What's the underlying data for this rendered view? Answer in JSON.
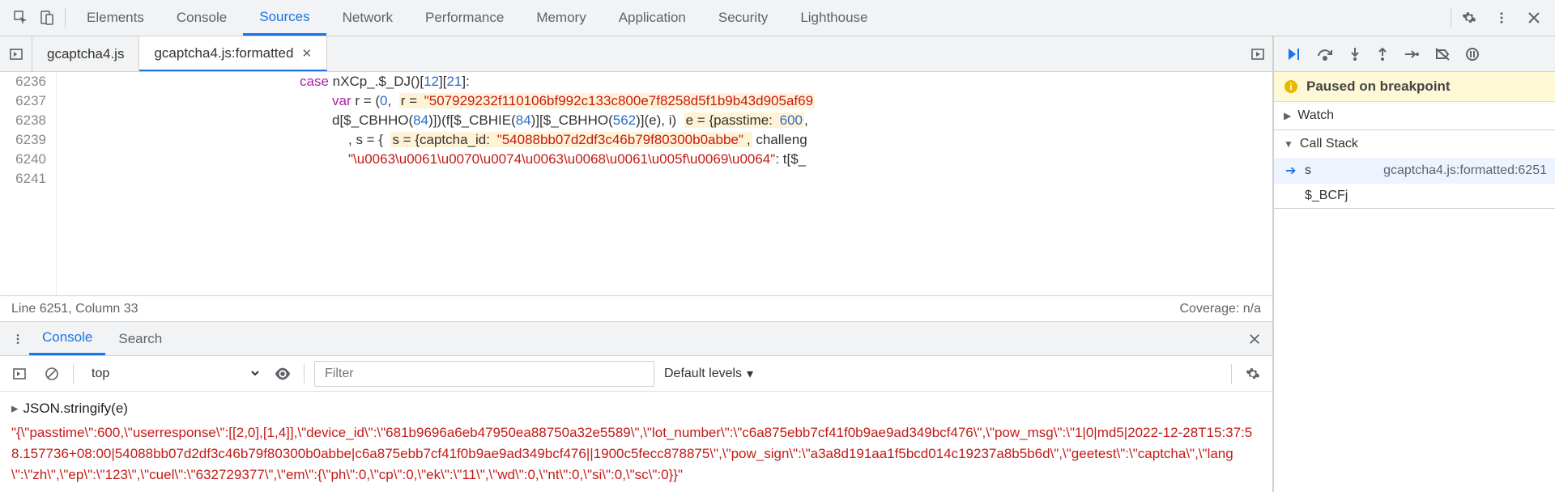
{
  "topTabs": {
    "items": [
      "Elements",
      "Console",
      "Sources",
      "Network",
      "Performance",
      "Memory",
      "Application",
      "Security",
      "Lighthouse"
    ],
    "activeIndex": 2
  },
  "sourceTabs": {
    "items": [
      {
        "label": "gcaptcha4.js",
        "closable": false
      },
      {
        "label": "gcaptcha4.js:formatted",
        "closable": true
      }
    ],
    "activeIndex": 1
  },
  "code": {
    "lineNumbers": [
      "6236",
      "6237",
      "6238",
      "6239",
      "6240",
      "6241"
    ],
    "lines": [
      {
        "parts": [
          {
            "t": "kw",
            "v": "case"
          },
          {
            "t": "p",
            "v": " nXCp_.$_DJ()["
          },
          {
            "t": "num",
            "v": "12"
          },
          {
            "t": "p",
            "v": "]["
          },
          {
            "t": "num",
            "v": "21"
          },
          {
            "t": "p",
            "v": "]:"
          }
        ]
      },
      {
        "indent": 40,
        "parts": [
          {
            "t": "kw",
            "v": "var"
          },
          {
            "t": "p",
            "v": " r = ("
          },
          {
            "t": "num",
            "v": "0"
          },
          {
            "t": "p",
            "v": ",  "
          },
          {
            "t": "hl",
            "v": "r = "
          },
          {
            "t": "hlstr",
            "v": "\"507929232f110106bf992c133c800e7f8258d5f1b9b43d905af69"
          }
        ]
      },
      {
        "indent": 40,
        "parts": [
          {
            "t": "p",
            "v": "d[$_CBHHO("
          },
          {
            "t": "num",
            "v": "84"
          },
          {
            "t": "p",
            "v": ")])(f[$_CBHIE("
          },
          {
            "t": "num",
            "v": "84"
          },
          {
            "t": "p",
            "v": ")][$_CBHHO("
          },
          {
            "t": "num",
            "v": "562"
          },
          {
            "t": "p",
            "v": ")](e), i)  "
          },
          {
            "t": "hl",
            "v": "e = {passtime: "
          },
          {
            "t": "hlnum",
            "v": "600"
          },
          {
            "t": "p",
            "v": ","
          }
        ]
      },
      {
        "indent": 60,
        "parts": [
          {
            "t": "p",
            "v": ", s = {  "
          },
          {
            "t": "hl",
            "v": "s = {captcha_id: "
          },
          {
            "t": "hlstr",
            "v": "\"54088bb07d2df3c46b79f80300b0abbe\""
          },
          {
            "t": "hl",
            "v": ","
          },
          {
            "t": "p",
            "v": " challeng"
          }
        ]
      },
      {
        "indent": 60,
        "parts": [
          {
            "t": "str",
            "v": "\"\\u0063\\u0061\\u0070\\u0074\\u0063\\u0068\\u0061\\u005f\\u0069\\u0064\""
          },
          {
            "t": "p",
            "v": ": t[$_"
          }
        ]
      },
      {
        "parts": []
      }
    ]
  },
  "statusBar": {
    "left": "Line 6251, Column 33",
    "right": "Coverage: n/a"
  },
  "drawer": {
    "tabs": [
      "Console",
      "Search"
    ],
    "activeIndex": 0,
    "context": "top",
    "filterPlaceholder": "Filter",
    "levels": "Default levels"
  },
  "consoleEntry": {
    "cmd": "JSON.stringify(e)",
    "output": "\"{\\\"passtime\\\":600,\\\"userresponse\\\":[[2,0],[1,4]],\\\"device_id\\\":\\\"681b9696a6eb47950ea88750a32e5589\\\",\\\"lot_number\\\":\\\"c6a875ebb7cf41f0b9ae9ad349bcf476\\\",\\\"pow_msg\\\":\\\"1|0|md5|2022-12-28T15:37:58.157736+08:00|54088bb07d2df3c46b79f80300b0abbe|c6a875ebb7cf41f0b9ae9ad349bcf476||1900c5fecc878875\\\",\\\"pow_sign\\\":\\\"a3a8d191aa1f5bcd014c19237a8b5b6d\\\",\\\"geetest\\\":\\\"captcha\\\",\\\"lang\\\":\\\"zh\\\",\\\"ep\\\":\\\"123\\\",\\\"cuel\\\":\\\"632729377\\\",\\\"em\\\":{\\\"ph\\\":0,\\\"cp\\\":0,\\\"ek\\\":\\\"11\\\",\\\"wd\\\":0,\\\"nt\\\":0,\\\"si\\\":0,\\\"sc\\\":0}}\""
  },
  "debugger": {
    "pausedText": "Paused on breakpoint",
    "sections": {
      "watch": "Watch",
      "callStack": "Call Stack"
    },
    "stack": [
      {
        "name": "s",
        "location": "gcaptcha4.js:formatted:6251",
        "current": true
      },
      {
        "name": "$_BCFj",
        "location": "",
        "current": false
      }
    ]
  }
}
